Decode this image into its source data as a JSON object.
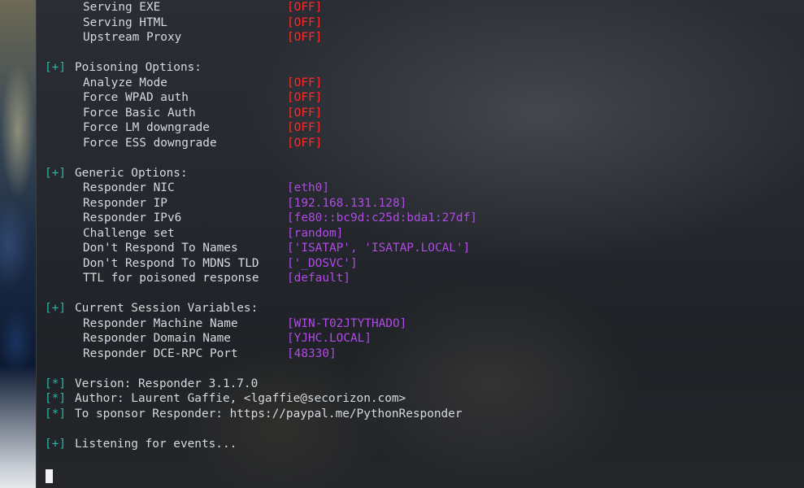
{
  "colors": {
    "prefix": "#2bb5a7",
    "off": "#ff2a2a",
    "value": "#b04be6",
    "text": "#d6d9de"
  },
  "servers_partial": [
    {
      "label": "Serving EXE",
      "value": "[OFF]"
    },
    {
      "label": "Serving HTML",
      "value": "[OFF]"
    },
    {
      "label": "Upstream Proxy",
      "value": "[OFF]"
    }
  ],
  "poisoning": {
    "prefix": "[+]",
    "header": "Poisoning Options:",
    "items": [
      {
        "label": "Analyze Mode",
        "value": "[OFF]"
      },
      {
        "label": "Force WPAD auth",
        "value": "[OFF]"
      },
      {
        "label": "Force Basic Auth",
        "value": "[OFF]"
      },
      {
        "label": "Force LM downgrade",
        "value": "[OFF]"
      },
      {
        "label": "Force ESS downgrade",
        "value": "[OFF]"
      }
    ]
  },
  "generic": {
    "prefix": "[+]",
    "header": "Generic Options:",
    "items": [
      {
        "label": "Responder NIC",
        "value": "[eth0]"
      },
      {
        "label": "Responder IP",
        "value": "[192.168.131.128]"
      },
      {
        "label": "Responder IPv6",
        "value": "[fe80::bc9d:c25d:bda1:27df]"
      },
      {
        "label": "Challenge set",
        "value": "[random]"
      },
      {
        "label": "Don't Respond To Names",
        "value": "['ISATAP', 'ISATAP.LOCAL']"
      },
      {
        "label": "Don't Respond To MDNS TLD",
        "value": "['_DOSVC']"
      },
      {
        "label": "TTL for poisoned response",
        "value": "[default]"
      }
    ]
  },
  "session": {
    "prefix": "[+]",
    "header": "Current Session Variables:",
    "items": [
      {
        "label": "Responder Machine Name",
        "value": "[WIN-T02JTYTHADO]"
      },
      {
        "label": "Responder Domain Name",
        "value": "[YJHC.LOCAL]"
      },
      {
        "label": "Responder DCE-RPC Port",
        "value": "[48330]"
      }
    ]
  },
  "info": [
    {
      "prefix": "[*]",
      "text": "Version: Responder 3.1.7.0"
    },
    {
      "prefix": "[*]",
      "text": "Author: Laurent Gaffie, <lgaffie@secorizon.com>"
    },
    {
      "prefix": "[*]",
      "text": "To sponsor Responder: https://paypal.me/PythonResponder"
    }
  ],
  "listening": {
    "prefix": "[+]",
    "text": "Listening for events..."
  }
}
